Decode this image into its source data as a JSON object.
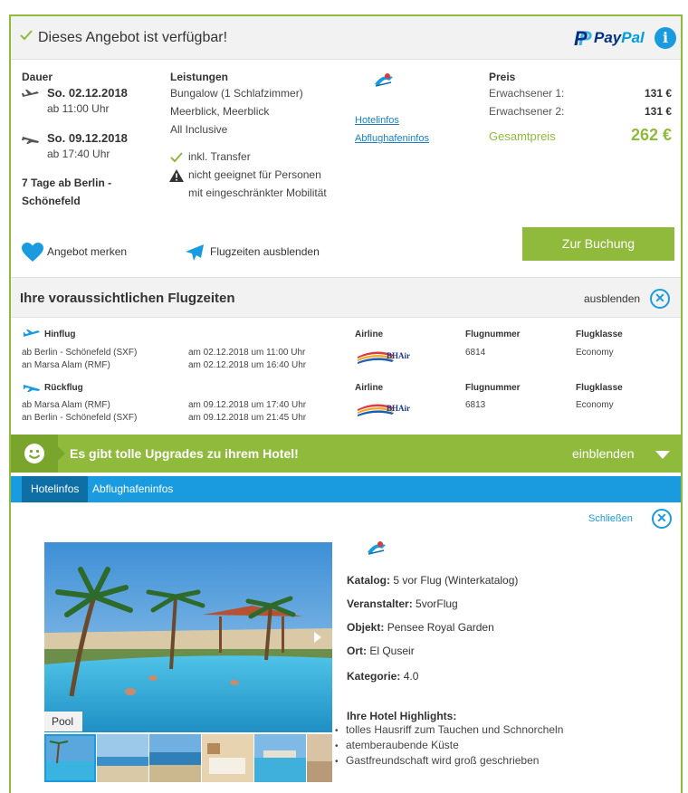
{
  "header": {
    "title": "Dieses Angebot ist verfügbar!",
    "paypal_word_dark": "Pay",
    "paypal_word_light": "Pal",
    "info_glyph": "i"
  },
  "offer": {
    "duration_label": "Dauer",
    "outbound_date": "So. 02.12.2018",
    "outbound_time": "ab 11:00 Uhr",
    "return_date": "So. 09.12.2018",
    "return_time": "ab 17:40 Uhr",
    "duration_line1": "7 Tage ab Berlin -",
    "duration_line2": "Schönefeld",
    "services_label": "Leistungen",
    "services": [
      "Bungalow (1 Schlafzimmer)",
      "Meerblick, Meerblick",
      "All Inclusive"
    ],
    "transfer": "inkl. Transfer",
    "mobility_line1": "nicht geeignet für Personen",
    "mobility_line2": "mit eingeschränkter Mobilität",
    "hotel_link": "Hotelinfos",
    "airport_link": "Abflughafeninfos",
    "price_label": "Preis",
    "adult1_label": "Erwachsener 1:",
    "adult1_price": "131 €",
    "adult2_label": "Erwachsener 2:",
    "adult2_price": "131 €",
    "total_label": "Gesamtpreis",
    "total_price": "262 €",
    "book_button": "Zur Buchung",
    "remember_label": "Angebot merken",
    "hide_flight_times_label": "Flugzeiten ausblenden"
  },
  "flight_times": {
    "title": "Ihre voraussichtlichen Flugzeiten",
    "hide_label": "ausblenden",
    "close_glyph": "✕",
    "legs": [
      {
        "name": "Hinflug",
        "from": "ab Berlin - Schönefeld (SXF)",
        "to": "an Marsa Alam (RMF)",
        "dep": "am 02.12.2018 um 11:00 Uhr",
        "arr": "am 02.12.2018 um 16:40 Uhr",
        "airline_label": "Airline",
        "airline_logo_text": "BHAir",
        "flightno_label": "Flugnummer",
        "flightno": "6814",
        "class_label": "Flugklasse",
        "class": "Economy"
      },
      {
        "name": "Rückflug",
        "from": "ab Marsa Alam (RMF)",
        "to": "an Berlin - Schönefeld (SXF)",
        "dep": "am 09.12.2018 um 17:40 Uhr",
        "arr": "am 09.12.2018 um 21:45 Uhr",
        "airline_label": "Airline",
        "airline_logo_text": "BHAir",
        "flightno_label": "Flugnummer",
        "flightno": "6813",
        "class_label": "Flugklasse",
        "class": "Economy"
      }
    ]
  },
  "upgrade": {
    "text": "Es gibt tolle Upgrades zu ihrem Hotel!",
    "show_label": "einblenden"
  },
  "tabs": [
    {
      "label": "Hotelinfos",
      "active": true
    },
    {
      "label": "Abflughafeninfos",
      "active": false
    }
  ],
  "hotel": {
    "close_label": "Schließen",
    "close_glyph": "✕",
    "photo_caption": "Pool",
    "catalog_label": "Katalog:",
    "catalog": "5 vor Flug (Winterkatalog)",
    "organizer_label": "Veranstalter:",
    "organizer": "5vorFlug",
    "object_label": "Objekt:",
    "object": "Pensee Royal Garden",
    "place_label": "Ort:",
    "place": "El Quseir",
    "category_label": "Kategorie:",
    "category": "4.0",
    "highlights_title": "Ihre Hotel Highlights:",
    "highlights": [
      "tolles Hausriff zum Tauchen und Schnorcheln",
      "atemberaubende Küste",
      "Gastfreundschaft wird groß geschrieben"
    ]
  },
  "colors": {
    "accent_green": "#8fba3b",
    "accent_blue": "#1a9be0",
    "tab_active": "#0e6fa6"
  }
}
